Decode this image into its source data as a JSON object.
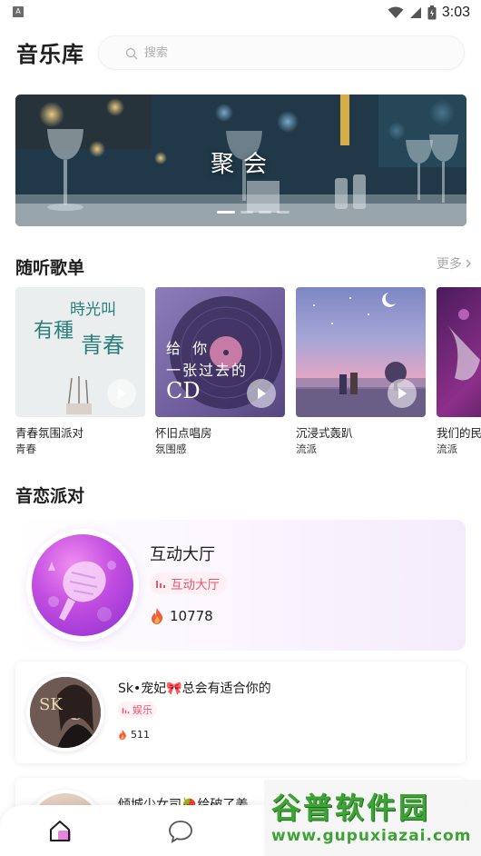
{
  "status_bar": {
    "app_icon_letter": "A",
    "time": "3:03",
    "icons": [
      "wifi-icon",
      "signal-icon",
      "battery-icon"
    ]
  },
  "header": {
    "title": "音乐库",
    "search_placeholder": "搜索"
  },
  "banner": {
    "title": "聚会",
    "page_count": 5,
    "active_index": 0
  },
  "playlists_section": {
    "title": "随听歌单",
    "more_label": "更多",
    "items": [
      {
        "name": "青春氛围派对",
        "tag": "青春",
        "cover_text_1": "時光叫",
        "cover_text_2": "有種",
        "cover_text_3": "青春"
      },
      {
        "name": "怀旧点唱房",
        "tag": "氛围感",
        "cover_text_1": "给 你",
        "cover_text_2": "一张过去的",
        "cover_text_3": "CD"
      },
      {
        "name": "沉浸式轰趴",
        "tag": "流派"
      },
      {
        "name": "我们的民",
        "tag": "流派"
      }
    ]
  },
  "party_section": {
    "title": "音恋派对",
    "hall": {
      "title": "互动大厅",
      "badge": "互动大厅",
      "count": "10778"
    },
    "rooms": [
      {
        "title": "Sk•宠妃🎀总会有适合你的",
        "tag": "娱乐",
        "hot": "511",
        "avatar_text": "SK"
      },
      {
        "title": "倾城少女司🍓给破了姜"
      }
    ]
  },
  "bottom_nav": {
    "items": [
      "home-icon",
      "chat-icon"
    ]
  },
  "watermark": {
    "title": "谷普软件园",
    "url": "www.gupuxiazai.com"
  },
  "colors": {
    "accent_pink": "#e9576e",
    "hall_purple": "#b040e0",
    "watermark_green": "#3da334"
  }
}
